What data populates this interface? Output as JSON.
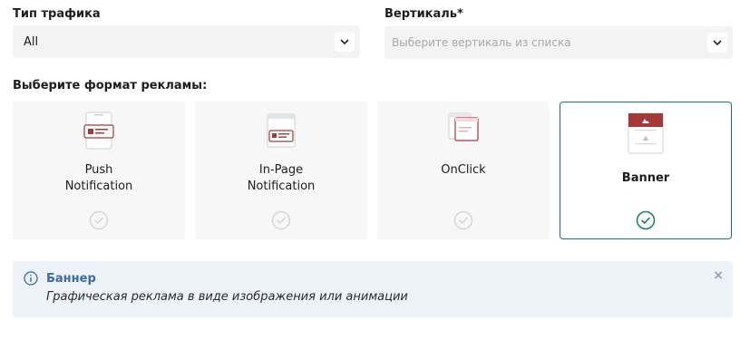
{
  "traffic": {
    "label": "Тип трафика",
    "value": "All"
  },
  "vertical": {
    "label": "Вертикаль*",
    "placeholder": "Выберите вертикаль из списка"
  },
  "formats": {
    "heading": "Выберите формат рекламы:",
    "items": [
      {
        "line1": "Push",
        "line2": "Notification"
      },
      {
        "line1": "In-Page",
        "line2": "Notification"
      },
      {
        "line1": "OnClick"
      },
      {
        "line1": "Banner",
        "selected": true
      }
    ]
  },
  "info": {
    "title": "Баннер",
    "text": "Графическая реклама в виде изображения или анимации",
    "close": "×"
  },
  "colors": {
    "accent": "#1c7a5a",
    "icon": "#a33a3a",
    "info_title": "#3d6aa6"
  }
}
